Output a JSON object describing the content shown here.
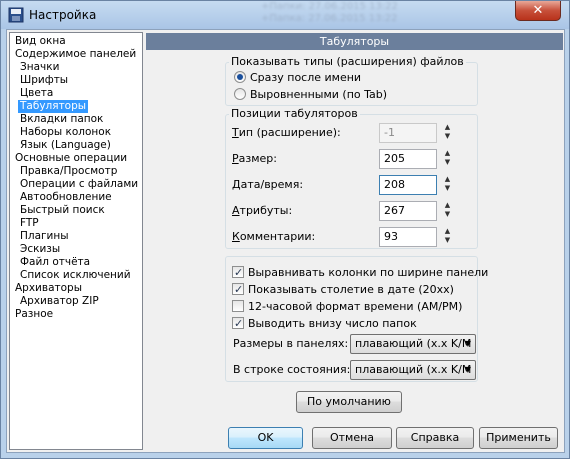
{
  "window": {
    "title": "Настройка",
    "background_text": [
      "+Папки: 27.06.2015 13:22",
      "+Папка: 27.06.2015 13:22"
    ]
  },
  "tree": {
    "items": [
      {
        "label": "Вид окна",
        "level": 0,
        "selected": false
      },
      {
        "label": "Содержимое панелей",
        "level": 0,
        "selected": false
      },
      {
        "label": "Значки",
        "level": 1,
        "selected": false
      },
      {
        "label": "Шрифты",
        "level": 1,
        "selected": false
      },
      {
        "label": "Цвета",
        "level": 1,
        "selected": false
      },
      {
        "label": "Табуляторы",
        "level": 1,
        "selected": true
      },
      {
        "label": "Вкладки папок",
        "level": 1,
        "selected": false
      },
      {
        "label": "Наборы колонок",
        "level": 1,
        "selected": false
      },
      {
        "label": "Язык (Language)",
        "level": 1,
        "selected": false
      },
      {
        "label": "Основные операции",
        "level": 0,
        "selected": false
      },
      {
        "label": "Правка/Просмотр",
        "level": 1,
        "selected": false
      },
      {
        "label": "Операции с файлами",
        "level": 1,
        "selected": false
      },
      {
        "label": "Автообновление",
        "level": 1,
        "selected": false
      },
      {
        "label": "Быстрый поиск",
        "level": 1,
        "selected": false
      },
      {
        "label": "FTP",
        "level": 1,
        "selected": false
      },
      {
        "label": "Плагины",
        "level": 1,
        "selected": false
      },
      {
        "label": "Эскизы",
        "level": 1,
        "selected": false
      },
      {
        "label": "Файл отчёта",
        "level": 1,
        "selected": false
      },
      {
        "label": "Список исключений",
        "level": 1,
        "selected": false
      },
      {
        "label": "Архиваторы",
        "level": 0,
        "selected": false
      },
      {
        "label": "Архиватор ZIP",
        "level": 1,
        "selected": false
      },
      {
        "label": "Разное",
        "level": 0,
        "selected": false
      }
    ]
  },
  "panel": {
    "header": "Табуляторы",
    "file_types_group": {
      "title": "Показывать типы (расширения) файлов",
      "option_after_name": "Сразу после имени",
      "option_aligned": "Выровненными (по Tab)",
      "selected": "after_name"
    },
    "tab_positions_group": {
      "title": "Позиции табуляторов",
      "fields": [
        {
          "label": "Тип (расширение):",
          "ul": "Т",
          "rest": "ип (расширение):",
          "value": "-1",
          "disabled": true,
          "focused": false
        },
        {
          "label": "Размер:",
          "ul": "Р",
          "rest": "азмер:",
          "value": "205",
          "disabled": false,
          "focused": false
        },
        {
          "label": "Дата/время:",
          "ul": "Д",
          "rest": "ата/время:",
          "value": "208",
          "disabled": false,
          "focused": true
        },
        {
          "label": "Атрибуты:",
          "ul": "А",
          "rest": "трибуты:",
          "value": "267",
          "disabled": false,
          "focused": false
        },
        {
          "label": "Комментарии:",
          "ul": "К",
          "rest": "омментарии:",
          "value": "93",
          "disabled": false,
          "focused": false
        }
      ]
    },
    "options_group": {
      "checkboxes": [
        {
          "label": "Выравнивать колонки по ширине панели",
          "checked": true
        },
        {
          "label": "Показывать столетие в дате (20xx)",
          "checked": true
        },
        {
          "label": "12-часовой формат времени (AM/PM)",
          "checked": false
        },
        {
          "label": "Выводить внизу число папок",
          "checked": true
        }
      ],
      "sizes_in_panels_label": "Размеры в панелях:",
      "sizes_in_panels_value": "плавающий (x.x K/M",
      "status_bar_label": "В строке состояния:",
      "status_bar_value": "плавающий (x.x K/M"
    },
    "default_button": "По умолчанию"
  },
  "buttons": {
    "ok": "OK",
    "cancel": "Отмена",
    "help": "Справка",
    "apply": "Применить"
  },
  "colors": {
    "selection": "#3399ff",
    "header": "#6b7f9c",
    "frame": "#b9d1ea",
    "close": "#c7503a"
  }
}
